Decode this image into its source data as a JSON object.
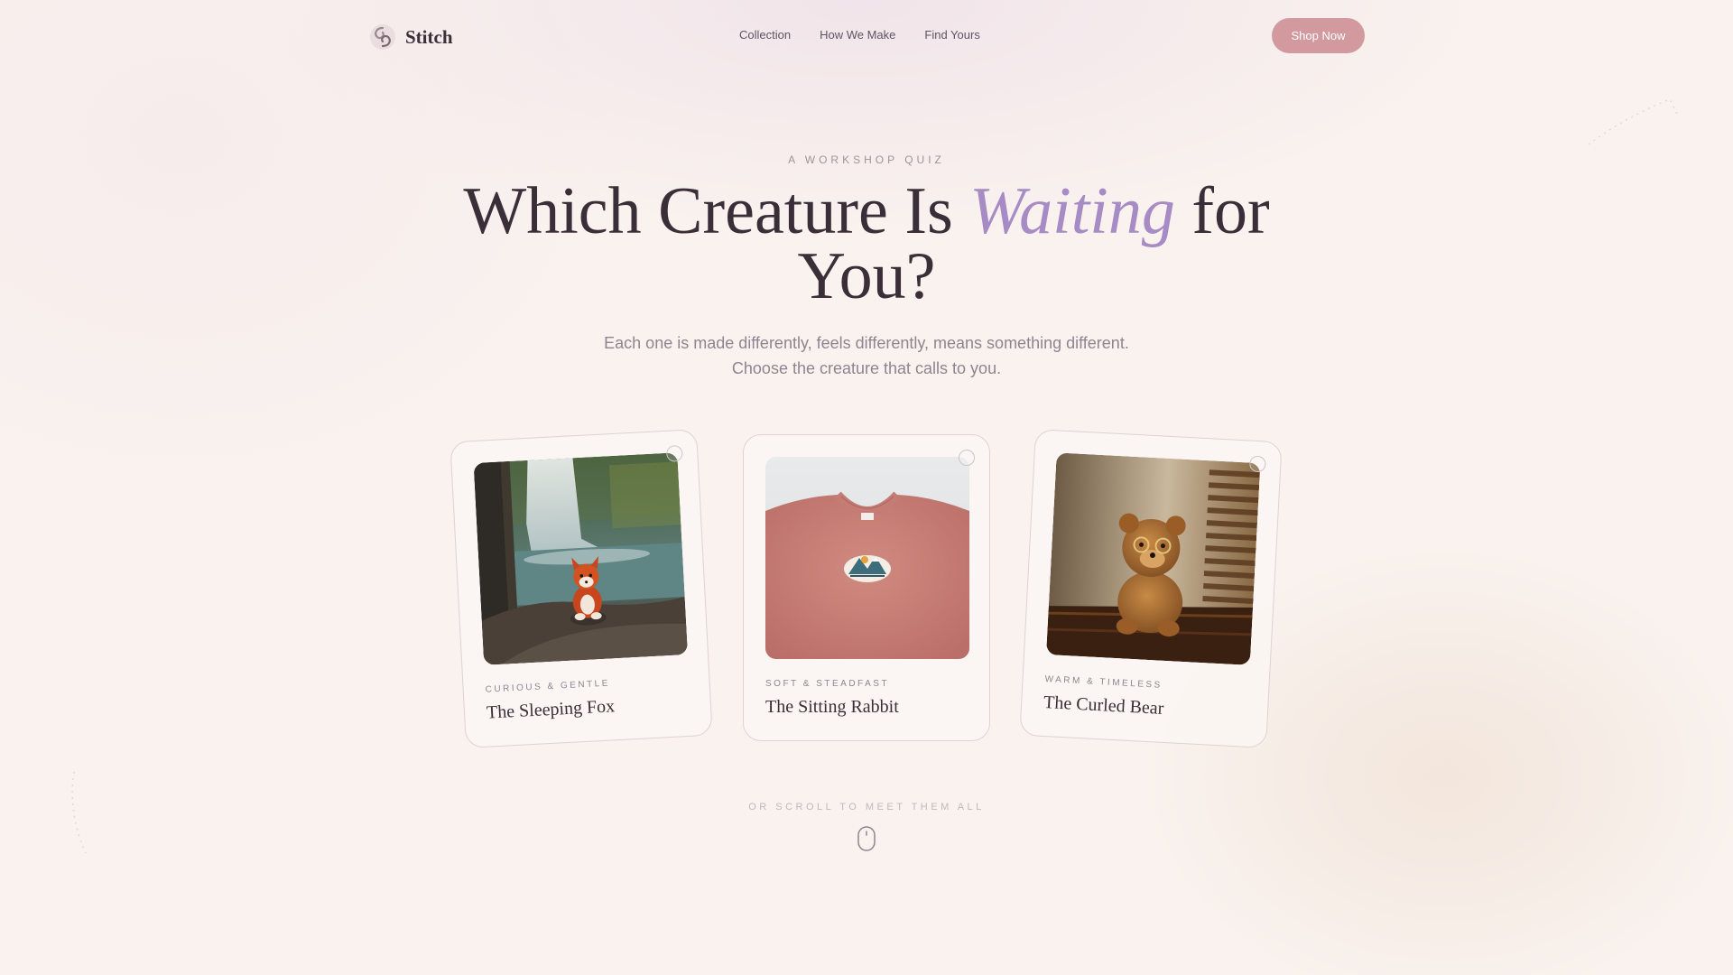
{
  "brand": {
    "name": "Stitch",
    "logo_icon": "swirl-logo-icon"
  },
  "nav": {
    "links": [
      "Collection",
      "How We Make",
      "Find Yours"
    ],
    "cta_label": "Shop Now"
  },
  "hero": {
    "eyebrow": "A WORKSHOP QUIZ",
    "headline_before": "Which Creature Is ",
    "headline_accent": "Waiting",
    "headline_after": " for You?",
    "subtitle": "Each one is made differently, feels differently, means something different. Choose the creature that calls to you."
  },
  "cards": [
    {
      "tag": "CURIOUS & GENTLE",
      "title": "The Sleeping Fox",
      "image": "plush fox sitting on a rock by a waterfall"
    },
    {
      "tag": "SOFT & STEADFAST",
      "title": "The Sitting Rabbit",
      "image": "pink sweatshirt with embroidered mountain patch"
    },
    {
      "tag": "WARM & TIMELESS",
      "title": "The Curled Bear",
      "image": "teddy bear with glasses beside a window blind"
    }
  ],
  "scroll_hint": "OR SCROLL TO MEET THEM ALL",
  "colors": {
    "background": "#f9f2ee",
    "accent_purple": "#a68bc4",
    "cta_pink": "#d29a9f",
    "heading": "#3a2f38",
    "muted": "#8e8590"
  }
}
